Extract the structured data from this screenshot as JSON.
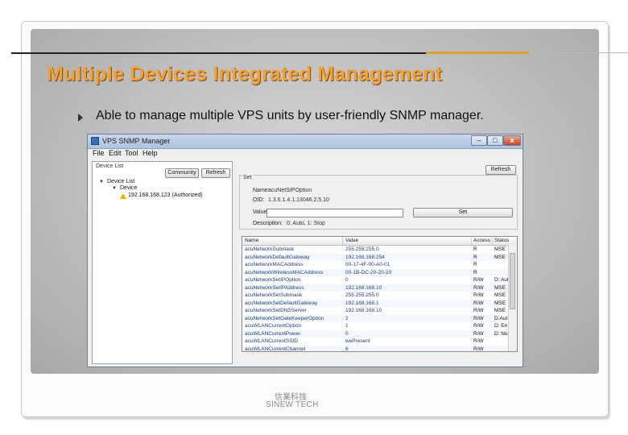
{
  "slide": {
    "title": "Multiple Devices Integrated Management",
    "bullet": "Able to manage multiple VPS units by user-friendly SNMP manager.",
    "footer_cn": "信業科技",
    "footer_en": "SINEW TECH",
    "colors": {
      "title": "#f2a03a",
      "accent_rule": "#e0a030"
    }
  },
  "window": {
    "title": "VPS SNMP Manager",
    "menu": [
      "File",
      "Edit",
      "Tool",
      "Help"
    ],
    "controls": {
      "minimize": "–",
      "maximize": "□",
      "close": "x"
    },
    "device_list": {
      "label": "Device List",
      "community_button": "Community",
      "refresh_button": "Refresh",
      "tree": {
        "root": "Device List",
        "child": "Device",
        "leaf": "192.168.168.123 (Authorized)"
      }
    },
    "get_refresh_button": "Refresh",
    "set_group": {
      "label": "Set",
      "name_label": "Name:",
      "name_value": "acuNetSIPOption",
      "oid_label": "OID:",
      "oid_value": "1.3.6.1.4.1.13046.2.5.10",
      "value_label": "Value:",
      "value_input": "",
      "set_button": "Set",
      "description_label": "Description:",
      "description_value": "0: Auto, 1: Stop"
    },
    "grid": {
      "columns": [
        "Name",
        "Value",
        "Access",
        "Status"
      ],
      "rows": [
        {
          "name": "acuNetworkSubmask",
          "value": "255.255.255.0",
          "access": "R",
          "status": "MSE"
        },
        {
          "name": "acuNetworkDefaultGateway",
          "value": "192.168.168.254",
          "access": "R",
          "status": "MSE"
        },
        {
          "name": "acuNetworkMACAddress",
          "value": "00-17-4F-00-A0-01",
          "access": "R",
          "status": ""
        },
        {
          "name": "acuNetworkWirelessMACAddress",
          "value": "00-1B-DC-20-20-20",
          "access": "R",
          "status": ""
        },
        {
          "name": "acuNetworkSetIPOption",
          "value": "0",
          "access": "R/W",
          "status": "D: Aut"
        },
        {
          "name": "acuNetworkSetIPAddress",
          "value": "192.168.168.10",
          "access": "R/W",
          "status": "MSE"
        },
        {
          "name": "acuNetworkSetSubmask",
          "value": "255.255.255.0",
          "access": "R/W",
          "status": "MSE"
        },
        {
          "name": "acuNetworkSetDefaultGateway",
          "value": "192.168.168.1",
          "access": "R/W",
          "status": "MSE"
        },
        {
          "name": "acuNetworkSetDNSServer",
          "value": "192.168.168.10",
          "access": "R/W",
          "status": "MSE"
        },
        {
          "name": "acuNetworkSetGateKeeperOption",
          "value": "2",
          "access": "R/W",
          "status": "D:Aut"
        },
        {
          "name": "acuWLANCurrentOption",
          "value": "1",
          "access": "R/W",
          "status": "D: En"
        },
        {
          "name": "acuWLANCurrentPower",
          "value": "0",
          "access": "R/W",
          "status": "D: No"
        },
        {
          "name": "acuWLANCurrentSSID",
          "value": "wePresent",
          "access": "R/W",
          "status": ""
        },
        {
          "name": "acuWLANCurrentChannel",
          "value": "6",
          "access": "R/W",
          "status": ""
        }
      ]
    }
  }
}
